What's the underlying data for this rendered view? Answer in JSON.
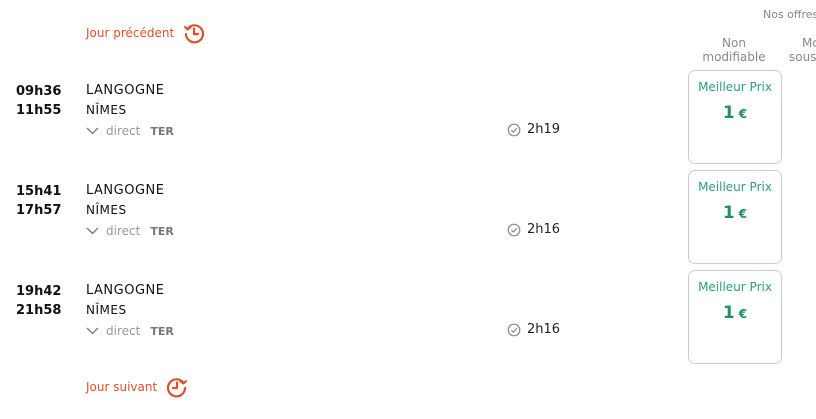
{
  "nav": {
    "previous_day": "Jour précédent",
    "next_day": "Jour suivant"
  },
  "offers": {
    "title": "Nos offres",
    "columns": [
      "Non modifiable",
      "Modifiable sous conditions"
    ],
    "column_lines": [
      [
        "Non",
        "modifiable"
      ],
      [
        "Mo",
        "sous"
      ]
    ]
  },
  "journeys": [
    {
      "departure_time": "09h36",
      "arrival_time": "11h55",
      "origin": "LANGOGNE",
      "destination": "NÎMES",
      "connection": "direct",
      "train_type": "TER",
      "duration": "2h19",
      "price_label": "Meilleur Prix",
      "price": "1",
      "currency": "€"
    },
    {
      "departure_time": "15h41",
      "arrival_time": "17h57",
      "origin": "LANGOGNE",
      "destination": "NÎMES",
      "connection": "direct",
      "train_type": "TER",
      "duration": "2h16",
      "price_label": "Meilleur Prix",
      "price": "1",
      "currency": "€"
    },
    {
      "departure_time": "19h42",
      "arrival_time": "21h58",
      "origin": "LANGOGNE",
      "destination": "NÎMES",
      "connection": "direct",
      "train_type": "TER",
      "duration": "2h16",
      "price_label": "Meilleur Prix",
      "price": "1",
      "currency": "€"
    }
  ],
  "icons": {
    "day_nav": "clock-history-icon",
    "expand": "chevron-down-icon",
    "duration": "clock-check-icon"
  },
  "colors": {
    "accent": "#e0502a",
    "price_green": "#1f8f66",
    "label_green": "#2d9c7a"
  }
}
